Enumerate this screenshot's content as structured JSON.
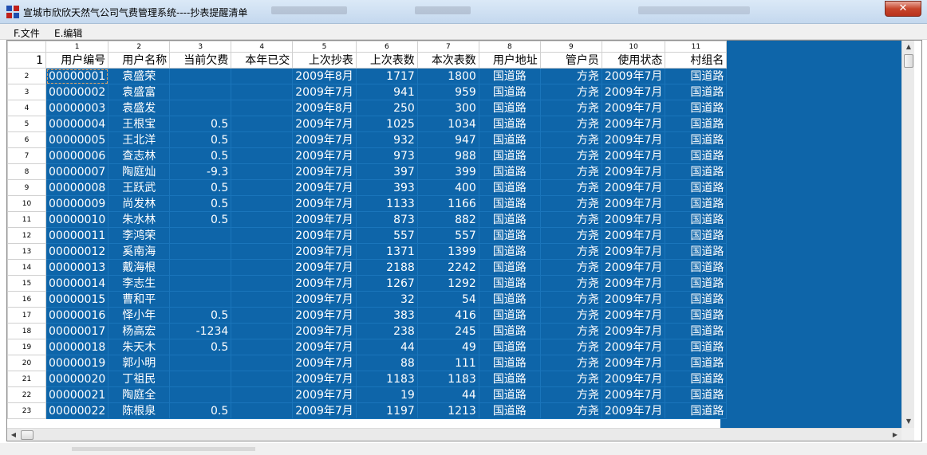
{
  "window": {
    "title": "宣城市欣欣天然气公司气费管理系统----抄表提醒清单",
    "close_glyph": "✕",
    "icon": "app-grid-icon"
  },
  "menu": [
    {
      "label": "F.文件"
    },
    {
      "label": "E.编辑"
    }
  ],
  "grid": {
    "column_numbers": [
      "1",
      "2",
      "3",
      "4",
      "5",
      "6",
      "7",
      "8",
      "9",
      "10",
      "11"
    ],
    "headers": [
      "用户编号",
      "用户名称",
      "当前欠费",
      "本年已交",
      "上次抄表",
      "上次表数",
      "本次表数",
      "用户地址",
      "管户员",
      "使用状态",
      "村组名"
    ],
    "header_row_number": "1",
    "rows": [
      {
        "n": "2",
        "id": "00000001",
        "name": "袁盛荣",
        "owe": "",
        "paid": "",
        "last_read": "2009年8月",
        "prev": "1717",
        "curr": "1800",
        "addr": "国道路",
        "mgr": "方尧",
        "status": "2009年7月",
        "group": "国道路"
      },
      {
        "n": "3",
        "id": "00000002",
        "name": "袁盛富",
        "owe": "",
        "paid": "",
        "last_read": "2009年7月",
        "prev": "941",
        "curr": "959",
        "addr": "国道路",
        "mgr": "方尧",
        "status": "2009年7月",
        "group": "国道路"
      },
      {
        "n": "4",
        "id": "00000003",
        "name": "袁盛发",
        "owe": "",
        "paid": "",
        "last_read": "2009年8月",
        "prev": "250",
        "curr": "300",
        "addr": "国道路",
        "mgr": "方尧",
        "status": "2009年7月",
        "group": "国道路"
      },
      {
        "n": "5",
        "id": "00000004",
        "name": "王根宝",
        "owe": "0.5",
        "paid": "",
        "last_read": "2009年7月",
        "prev": "1025",
        "curr": "1034",
        "addr": "国道路",
        "mgr": "方尧",
        "status": "2009年7月",
        "group": "国道路"
      },
      {
        "n": "6",
        "id": "00000005",
        "name": "王北洋",
        "owe": "0.5",
        "paid": "",
        "last_read": "2009年7月",
        "prev": "932",
        "curr": "947",
        "addr": "国道路",
        "mgr": "方尧",
        "status": "2009年7月",
        "group": "国道路"
      },
      {
        "n": "7",
        "id": "00000006",
        "name": "查志林",
        "owe": "0.5",
        "paid": "",
        "last_read": "2009年7月",
        "prev": "973",
        "curr": "988",
        "addr": "国道路",
        "mgr": "方尧",
        "status": "2009年7月",
        "group": "国道路"
      },
      {
        "n": "8",
        "id": "00000007",
        "name": "陶庭灿",
        "owe": "-9.3",
        "paid": "",
        "last_read": "2009年7月",
        "prev": "397",
        "curr": "399",
        "addr": "国道路",
        "mgr": "方尧",
        "status": "2009年7月",
        "group": "国道路"
      },
      {
        "n": "9",
        "id": "00000008",
        "name": "王跃武",
        "owe": "0.5",
        "paid": "",
        "last_read": "2009年7月",
        "prev": "393",
        "curr": "400",
        "addr": "国道路",
        "mgr": "方尧",
        "status": "2009年7月",
        "group": "国道路"
      },
      {
        "n": "10",
        "id": "00000009",
        "name": "尚发林",
        "owe": "0.5",
        "paid": "",
        "last_read": "2009年7月",
        "prev": "1133",
        "curr": "1166",
        "addr": "国道路",
        "mgr": "方尧",
        "status": "2009年7月",
        "group": "国道路"
      },
      {
        "n": "11",
        "id": "00000010",
        "name": "朱水林",
        "owe": "0.5",
        "paid": "",
        "last_read": "2009年7月",
        "prev": "873",
        "curr": "882",
        "addr": "国道路",
        "mgr": "方尧",
        "status": "2009年7月",
        "group": "国道路"
      },
      {
        "n": "12",
        "id": "00000011",
        "name": "李鸿荣",
        "owe": "",
        "paid": "",
        "last_read": "2009年7月",
        "prev": "557",
        "curr": "557",
        "addr": "国道路",
        "mgr": "方尧",
        "status": "2009年7月",
        "group": "国道路"
      },
      {
        "n": "13",
        "id": "00000012",
        "name": "奚南海",
        "owe": "",
        "paid": "",
        "last_read": "2009年7月",
        "prev": "1371",
        "curr": "1399",
        "addr": "国道路",
        "mgr": "方尧",
        "status": "2009年7月",
        "group": "国道路"
      },
      {
        "n": "14",
        "id": "00000013",
        "name": "戴海根",
        "owe": "",
        "paid": "",
        "last_read": "2009年7月",
        "prev": "2188",
        "curr": "2242",
        "addr": "国道路",
        "mgr": "方尧",
        "status": "2009年7月",
        "group": "国道路"
      },
      {
        "n": "15",
        "id": "00000014",
        "name": "李志生",
        "owe": "",
        "paid": "",
        "last_read": "2009年7月",
        "prev": "1267",
        "curr": "1292",
        "addr": "国道路",
        "mgr": "方尧",
        "status": "2009年7月",
        "group": "国道路"
      },
      {
        "n": "16",
        "id": "00000015",
        "name": "曹和平",
        "owe": "",
        "paid": "",
        "last_read": "2009年7月",
        "prev": "32",
        "curr": "54",
        "addr": "国道路",
        "mgr": "方尧",
        "status": "2009年7月",
        "group": "国道路"
      },
      {
        "n": "17",
        "id": "00000016",
        "name": "怿小年",
        "owe": "0.5",
        "paid": "",
        "last_read": "2009年7月",
        "prev": "383",
        "curr": "416",
        "addr": "国道路",
        "mgr": "方尧",
        "status": "2009年7月",
        "group": "国道路"
      },
      {
        "n": "18",
        "id": "00000017",
        "name": "杨高宏",
        "owe": "-1234",
        "paid": "",
        "last_read": "2009年7月",
        "prev": "238",
        "curr": "245",
        "addr": "国道路",
        "mgr": "方尧",
        "status": "2009年7月",
        "group": "国道路"
      },
      {
        "n": "19",
        "id": "00000018",
        "name": "朱天木",
        "owe": "0.5",
        "paid": "",
        "last_read": "2009年7月",
        "prev": "44",
        "curr": "49",
        "addr": "国道路",
        "mgr": "方尧",
        "status": "2009年7月",
        "group": "国道路"
      },
      {
        "n": "20",
        "id": "00000019",
        "name": "郭小明",
        "owe": "",
        "paid": "",
        "last_read": "2009年7月",
        "prev": "88",
        "curr": "111",
        "addr": "国道路",
        "mgr": "方尧",
        "status": "2009年7月",
        "group": "国道路"
      },
      {
        "n": "21",
        "id": "00000020",
        "name": "丁祖民",
        "owe": "",
        "paid": "",
        "last_read": "2009年7月",
        "prev": "1183",
        "curr": "1183",
        "addr": "国道路",
        "mgr": "方尧",
        "status": "2009年7月",
        "group": "国道路"
      },
      {
        "n": "22",
        "id": "00000021",
        "name": "陶庭全",
        "owe": "",
        "paid": "",
        "last_read": "2009年7月",
        "prev": "19",
        "curr": "44",
        "addr": "国道路",
        "mgr": "方尧",
        "status": "2009年7月",
        "group": "国道路"
      },
      {
        "n": "23",
        "id": "00000022",
        "name": "陈根泉",
        "owe": "0.5",
        "paid": "",
        "last_read": "2009年7月",
        "prev": "1197",
        "curr": "1213",
        "addr": "国道路",
        "mgr": "方尧",
        "status": "2009年7月",
        "group": "国道路"
      }
    ]
  },
  "scrollbars": {
    "up": "▲",
    "down": "▼",
    "left": "◀",
    "right": "▶"
  },
  "colors": {
    "selection_blue": "#0e65a9",
    "titlebar": "#c4d8ee",
    "close_red": "#c7452c"
  }
}
